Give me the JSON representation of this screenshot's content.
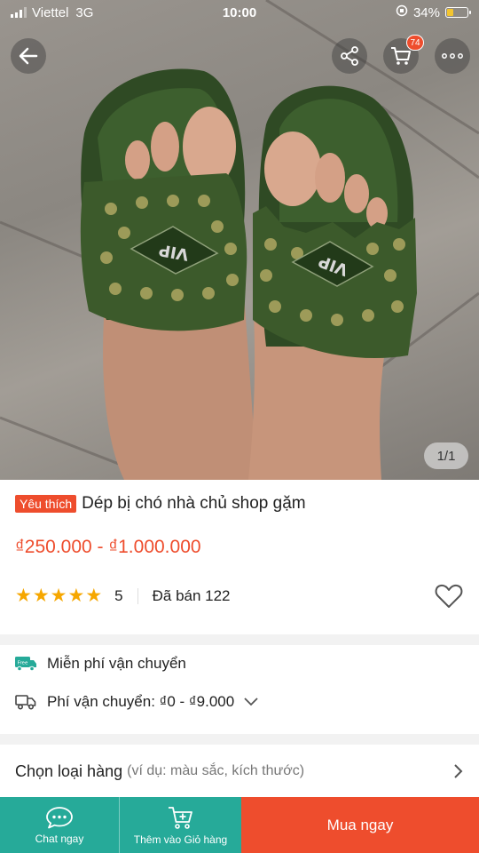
{
  "status_bar": {
    "carrier": "Viettel",
    "network": "3G",
    "time": "10:00",
    "battery": "34%",
    "battery_level": 0.34
  },
  "header": {
    "icons": [
      "back-arrow-icon",
      "share-icon",
      "cart-icon",
      "more-icon"
    ],
    "cart_count": "74"
  },
  "gallery": {
    "counter": "1/1",
    "print": "VIP"
  },
  "product": {
    "badge": "Yêu thích",
    "title": "Dép bị chó nhà chủ shop gặm",
    "price": "₫250.000 - ₫1.000.000",
    "rating": "5",
    "sold": "Đã bán 122",
    "star_count": 5
  },
  "shipping": {
    "free_badge": "Free",
    "free_label": "Miễn phí vận chuyển",
    "fee_label": "Phí vận chuyển: ₫0 - ₫9.000"
  },
  "variation": {
    "label": "Chọn loại hàng",
    "hint": "(ví dụ: màu sắc, kích thước)"
  },
  "bottom_bar": {
    "chat_label": "Chat ngay",
    "add_to_cart_label": "Thêm vào Giỏ hàng",
    "buy_label": "Mua ngay"
  },
  "colors": {
    "brand_orange": "#ee4d2d",
    "teal": "#26aa99",
    "star": "#f6a700"
  }
}
